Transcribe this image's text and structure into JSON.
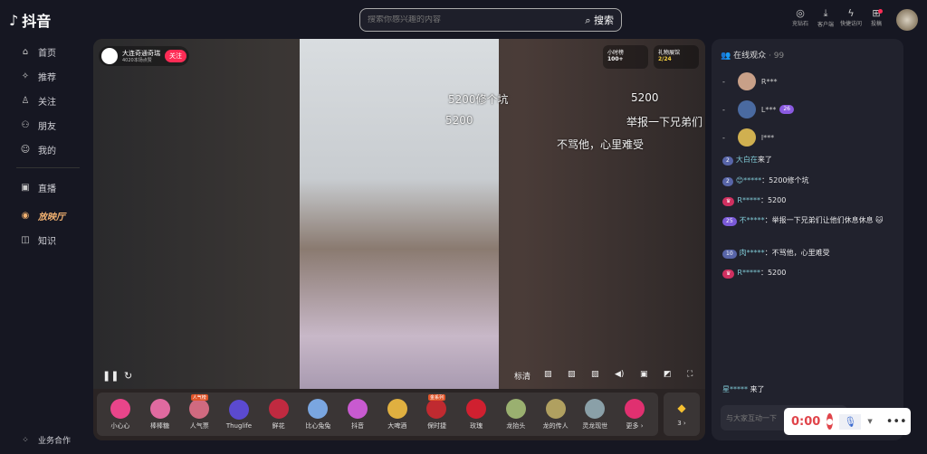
{
  "app": {
    "title": "抖音"
  },
  "search": {
    "placeholder": "搜索你感兴趣的内容",
    "button": "搜索"
  },
  "top_actions": [
    {
      "icon": "diamond-icon",
      "label": "充钻石"
    },
    {
      "icon": "download-icon",
      "label": "客户端"
    },
    {
      "icon": "lightning-icon",
      "label": "快捷访问"
    },
    {
      "icon": "upload-icon",
      "label": "投稿"
    }
  ],
  "sidebar": {
    "items": [
      {
        "icon": "home-icon",
        "label": "首页"
      },
      {
        "icon": "recommend-icon",
        "label": "推荐"
      },
      {
        "icon": "follow-icon",
        "label": "关注"
      },
      {
        "icon": "friends-icon",
        "label": "朋友"
      },
      {
        "icon": "profile-icon",
        "label": "我的"
      },
      {
        "icon": "live-icon",
        "label": "直播"
      },
      {
        "icon": "cinema-icon",
        "label": "放映厅"
      },
      {
        "icon": "knowledge-icon",
        "label": "知识"
      }
    ],
    "footer": "业务合作"
  },
  "stream": {
    "name": "大连奇通奇瑞",
    "likes": "4020本场点赞",
    "follow": "关注",
    "badges": [
      {
        "label": "小时榜",
        "value": "100+"
      },
      {
        "label": "礼物展馆",
        "value": "2/24"
      }
    ]
  },
  "danmaku": [
    "5200修个坑",
    "5200",
    "5200",
    "举报一下兄弟们",
    "不骂他，心里难受"
  ],
  "controls": {
    "quality": "标清"
  },
  "gifts": [
    {
      "label": "小心心",
      "color": "#e8458a"
    },
    {
      "label": "棒棒糖",
      "color": "#e06aa0"
    },
    {
      "label": "人气票",
      "color": "#d06a80",
      "tag": "人气榜"
    },
    {
      "label": "Thuglife",
      "color": "#5b4ad0"
    },
    {
      "label": "鲜花",
      "color": "#c02a40"
    },
    {
      "label": "比心兔兔",
      "color": "#7aa6e0"
    },
    {
      "label": "抖音",
      "color": "#c85ad0"
    },
    {
      "label": "大啤酒",
      "color": "#e0b040"
    },
    {
      "label": "保时捷",
      "color": "#c02a30",
      "tag": "金系列"
    },
    {
      "label": "玫瑰",
      "color": "#d02030"
    },
    {
      "label": "龙抬头",
      "color": "#9ab070"
    },
    {
      "label": "龙的传人",
      "color": "#b0a060"
    },
    {
      "label": "灵龙现世",
      "color": "#8aa0a8"
    },
    {
      "label": "更多 ›",
      "color": "#e03070"
    }
  ],
  "diamonds": "3 ›",
  "panel": {
    "title": "在线观众",
    "count": "· 99",
    "viewers": [
      {
        "rank": "-",
        "name": "R***",
        "color": "#c8a088"
      },
      {
        "rank": "-",
        "name": "L***",
        "badge": "26",
        "color": "#4a6aa0"
      },
      {
        "rank": "-",
        "name": "l***",
        "color": "#d0b050"
      }
    ],
    "messages": [
      {
        "level": "2",
        "user": "大白在",
        "text": "来了"
      },
      {
        "level": "2",
        "user": "😊*****",
        "text": "：5200修个坑"
      },
      {
        "level": "♛",
        "user": "R*****",
        "text": "：5200",
        "pink": true
      },
      {
        "level": "25",
        "user": "不*****",
        "text": "：举报一下兄弟们让他们休息休息 🐱",
        "purple": true
      },
      {
        "level": "10",
        "user": "肉*****",
        "text": "：不骂他，心里难受"
      },
      {
        "level": "♛",
        "user": "R*****",
        "text": "：5200",
        "pink": true
      }
    ],
    "arrival": {
      "user": "星*****",
      "text": "来了"
    },
    "input_placeholder": "与大家互动一下"
  },
  "recorder": {
    "time": "0:00"
  },
  "colors": {
    "accent": "#fe2c55",
    "record": "#e0444a"
  }
}
